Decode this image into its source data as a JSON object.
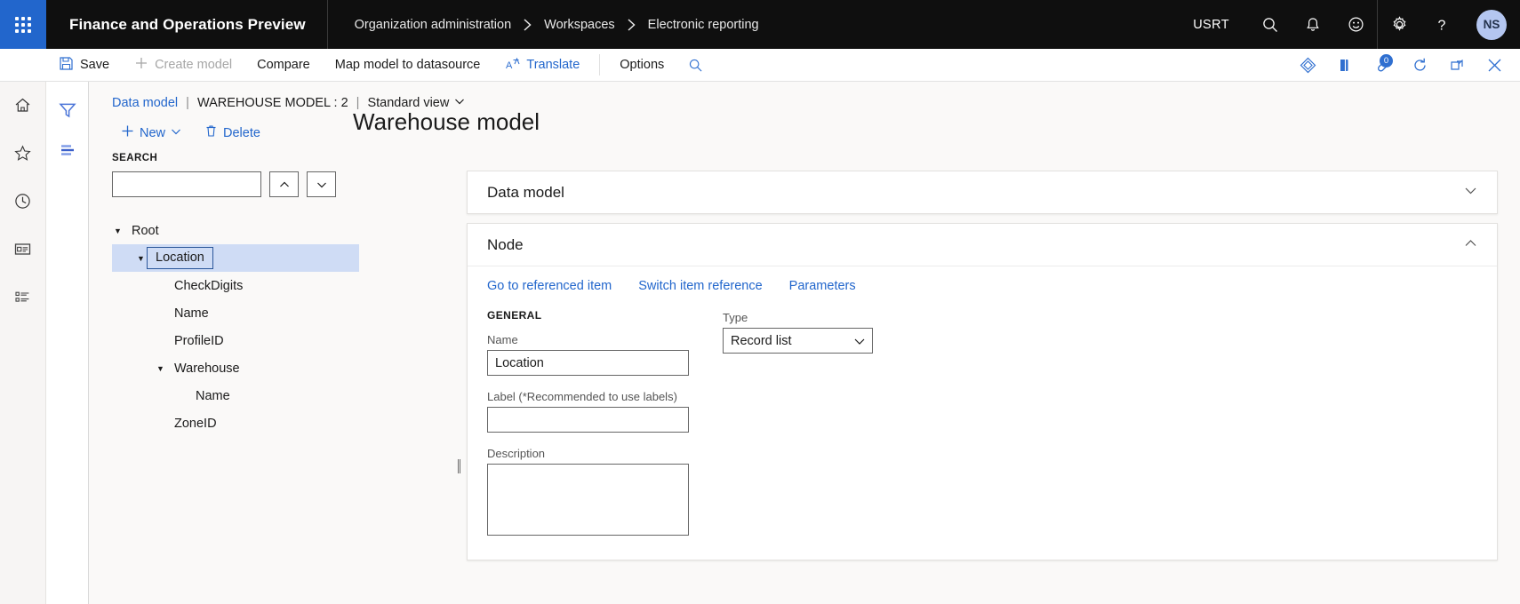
{
  "topbar": {
    "waffle_name": "app-launcher",
    "brand": "Finance and Operations Preview",
    "breadcrumbs": [
      "Organization administration",
      "Workspaces",
      "Electronic reporting"
    ],
    "company": "USRT",
    "icons": [
      "search-icon",
      "notifications-bell-icon",
      "feedback-smiley-icon",
      "settings-gear-icon",
      "help-question-icon"
    ],
    "avatar_initials": "NS",
    "background_color": "#0f0f0f",
    "accent_color": "#2266cc"
  },
  "toolbar": {
    "save_label": "Save",
    "create_model_label": "Create model",
    "compare_label": "Compare",
    "map_model_label": "Map model to datasource",
    "translate_label": "Translate",
    "options_label": "Options",
    "search_icon": "search-icon",
    "right_icons": [
      "diamond-attachments-icon",
      "office-app-icon",
      "attachments-icon",
      "refresh-icon",
      "open-in-new-window-icon",
      "close-icon"
    ],
    "attachment_badge": "0"
  },
  "navrail": {
    "icons": [
      "home-icon",
      "favorites-star-icon",
      "recent-clock-icon",
      "workspaces-icon",
      "modules-list-icon"
    ]
  },
  "rail2": {
    "icons": [
      "filter-funnel-icon",
      "list-lines-icon"
    ]
  },
  "page": {
    "view_line": {
      "data_model_link": "Data model",
      "separator": "|",
      "model_name": "WAREHOUSE MODEL : 2",
      "view_name": "Standard view",
      "view_chevron": "chevron-down-icon"
    },
    "commands": {
      "new_label": "New",
      "new_chevron": "chevron-down-icon",
      "delete_label": "Delete",
      "delete_icon": "trash-icon",
      "new_icon": "plus-icon"
    },
    "title": "Warehouse model"
  },
  "tree_panel": {
    "search_label": "SEARCH",
    "search_value": "",
    "search_placeholder": "",
    "prev_button_icon": "chevron-up-icon",
    "next_button_icon": "chevron-down-icon",
    "nodes": [
      {
        "label": "Root",
        "indent": 0,
        "caret": true,
        "selected": false
      },
      {
        "label": "Location",
        "indent": 1,
        "caret": true,
        "selected": true
      },
      {
        "label": "CheckDigits",
        "indent": 2,
        "caret": false,
        "selected": false
      },
      {
        "label": "Name",
        "indent": 2,
        "caret": false,
        "selected": false
      },
      {
        "label": "ProfileID",
        "indent": 2,
        "caret": false,
        "selected": false
      },
      {
        "label": "Warehouse",
        "indent": 2,
        "caret": true,
        "selected": false
      },
      {
        "label": "Name",
        "indent": 3,
        "caret": false,
        "selected": false
      },
      {
        "label": "ZoneID",
        "indent": 2,
        "caret": false,
        "selected": false
      }
    ]
  },
  "cards": {
    "data_model": {
      "title": "Data model",
      "chevron": "chevron-down-icon",
      "expanded": false
    },
    "node": {
      "title": "Node",
      "chevron": "chevron-up-icon",
      "expanded": true,
      "links": [
        "Go to referenced item",
        "Switch item reference",
        "Parameters"
      ],
      "general_group_title": "GENERAL",
      "fields": {
        "name_label": "Name",
        "name_value": "Location",
        "label_label": "Label (*Recommended to use labels)",
        "label_value": "",
        "description_label": "Description",
        "description_value": "",
        "type_label": "Type",
        "type_value": "Record list",
        "type_chevron": "chevron-down-icon"
      }
    }
  },
  "splitter": {
    "name": "panel-splitter"
  }
}
